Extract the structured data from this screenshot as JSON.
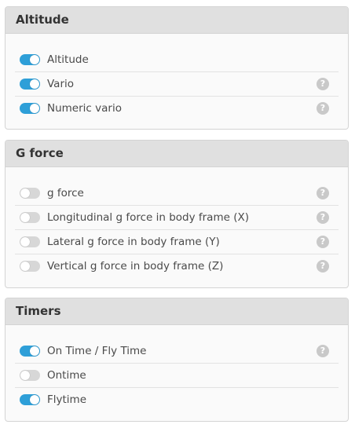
{
  "colors": {
    "toggle_on": "#2e9fd8",
    "toggle_off": "#d7d7d7",
    "header_bg": "#e0e0e0",
    "help_icon": "#c9c9c9"
  },
  "help_glyph": "?",
  "sections": [
    {
      "title": "Altitude",
      "items": [
        {
          "label": "Altitude",
          "enabled": true,
          "help": false
        },
        {
          "label": "Vario",
          "enabled": true,
          "help": true
        },
        {
          "label": "Numeric vario",
          "enabled": true,
          "help": true
        }
      ]
    },
    {
      "title": "G force",
      "items": [
        {
          "label": "g force",
          "enabled": false,
          "help": true
        },
        {
          "label": "Longitudinal g force in body frame (X)",
          "enabled": false,
          "help": true
        },
        {
          "label": "Lateral g force in body frame (Y)",
          "enabled": false,
          "help": true
        },
        {
          "label": "Vertical g force in body frame (Z)",
          "enabled": false,
          "help": true
        }
      ]
    },
    {
      "title": "Timers",
      "items": [
        {
          "label": "On Time / Fly Time",
          "enabled": true,
          "help": true
        },
        {
          "label": "Ontime",
          "enabled": false,
          "help": false
        },
        {
          "label": "Flytime",
          "enabled": true,
          "help": false
        }
      ]
    }
  ]
}
